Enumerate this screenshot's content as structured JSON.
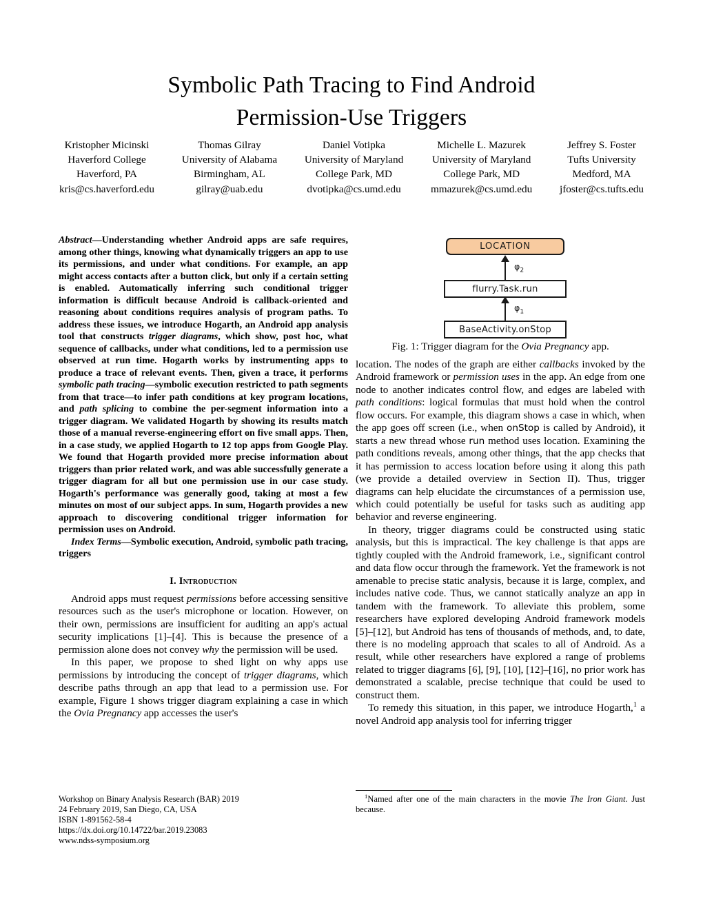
{
  "paper": {
    "title_lines": [
      "Symbolic Path Tracing to Find Android",
      "Permission-Use Triggers"
    ],
    "authors": [
      {
        "name": "Kristopher Micinski",
        "org": "Haverford College",
        "location": "Haverford, PA",
        "email": "kris@cs.haverford.edu"
      },
      {
        "name": "Thomas Gilray",
        "org": "University of Alabama",
        "location": "Birmingham, AL",
        "email": "gilray@uab.edu"
      },
      {
        "name": "Daniel Votipka",
        "org": "University of Maryland",
        "location": "College Park, MD",
        "email": "dvotipka@cs.umd.edu"
      },
      {
        "name": "Michelle L. Mazurek",
        "org": "University of Maryland",
        "location": "College Park, MD",
        "email": "mmazurek@cs.umd.edu"
      },
      {
        "name": "Jeffrey S. Foster",
        "org": "Tufts University",
        "location": "Medford, MA",
        "email": "jfoster@cs.tufts.edu"
      }
    ],
    "abstract": {
      "lead": "Abstract",
      "dash": "—",
      "text": "Understanding whether Android apps are safe requires, among other things, knowing what dynamically triggers an app to use its permissions, and under what conditions. For example, an app might access contacts after a button click, but only if a certain setting is enabled. Automatically inferring such conditional trigger information is difficult because Android is callback-oriented and reasoning about conditions requires analysis of program paths. To address these issues, we introduce Hogarth, an Android app analysis tool that constructs "
    },
    "index_terms": {
      "lead": "Index Terms",
      "dash": "—",
      "text": "Symbolic execution, Android, symbolic path tracing, triggers"
    },
    "section1": {
      "numeral": "I.",
      "title": "Introduction"
    },
    "figure1": {
      "caption_prefix": "Fig. 1: Trigger diagram for the ",
      "caption_italic": "Ovia Pregnancy",
      "caption_suffix": " app.",
      "nodes": [
        {
          "id": "location",
          "label": "LOCATION",
          "kind": "permission-use",
          "color": "#F8CBA0"
        },
        {
          "id": "task-run",
          "label": "flurry.Task.run",
          "kind": "callback",
          "color": "#FFFFFF"
        },
        {
          "id": "on-stop",
          "label": "BaseActivity.onStop",
          "kind": "callback",
          "color": "#FFFFFF"
        }
      ],
      "edges": [
        {
          "from": "task-run",
          "to": "location",
          "label": "φ",
          "subscript": "2"
        },
        {
          "from": "on-stop",
          "to": "task-run",
          "label": "φ",
          "subscript": "1"
        }
      ]
    },
    "footnote": {
      "marker": "1",
      "text_before": "Named after one of the main characters in the movie ",
      "text_italic": "The Iron Giant",
      "text_after": ". Just because."
    },
    "publication_info": [
      "Workshop on Binary Analysis Research (BAR) 2019",
      "24 February 2019, San Diego, CA, USA",
      "ISBN 1-891562-58-4",
      "https://dx.doi.org/10.14722/bar.2019.23083",
      "www.ndss-symposium.org"
    ]
  }
}
